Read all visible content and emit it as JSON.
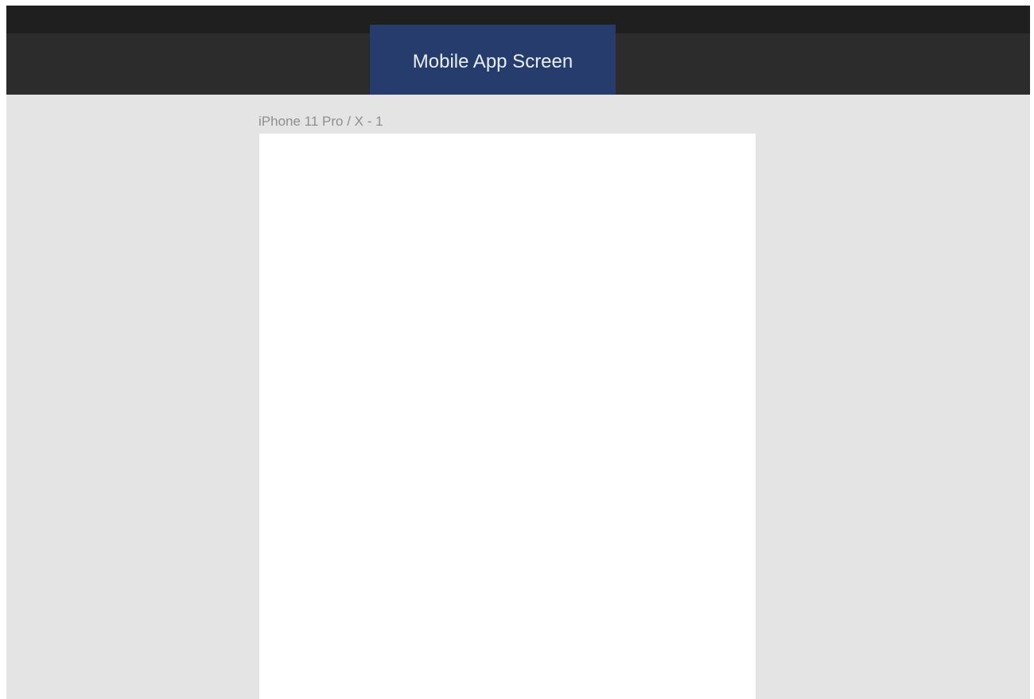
{
  "toolbar": {
    "document_title": "Mobile App Screen"
  },
  "canvas": {
    "artboard": {
      "label": "iPhone 11 Pro / X - 1"
    }
  },
  "colors": {
    "top_strip": "#1f1f1f",
    "toolbar_bg": "#2c2c2c",
    "title_tab_bg": "#263c6d",
    "title_tab_text": "#e8eefc",
    "canvas_bg": "#e4e4e4",
    "artboard_bg": "#ffffff",
    "artboard_label": "#8e8e8e"
  }
}
